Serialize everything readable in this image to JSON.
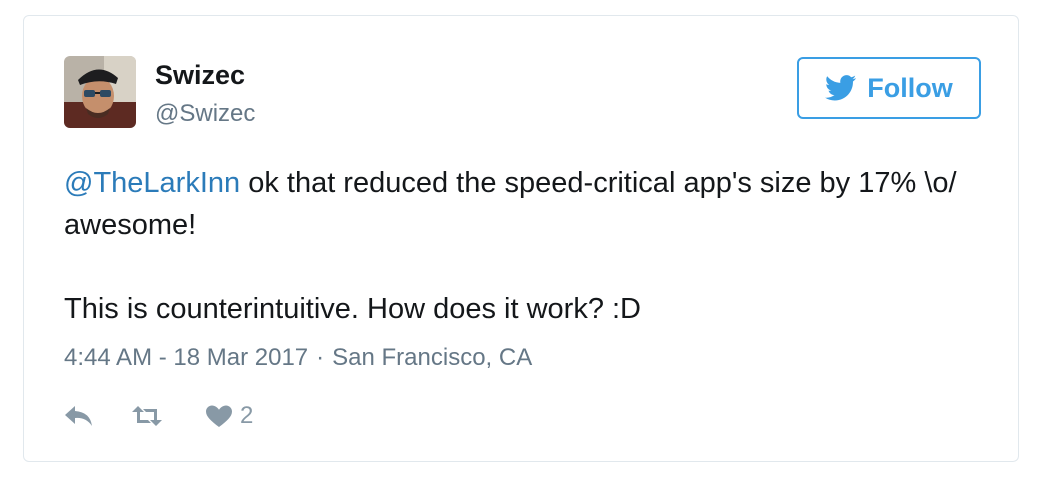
{
  "tweet": {
    "author_name": "Swizec",
    "author_handle": "@Swizec",
    "follow_label": "Follow",
    "mention": "@TheLarkInn",
    "text_line1": " ok that reduced the speed-critical app's size by 17% \\o/ awesome!",
    "text_line2": "This is counterintuitive. How does it work? :D",
    "time": "4:44 AM - 18 Mar 2017",
    "separator": "·",
    "location": "San Francisco, CA",
    "like_count": "2"
  },
  "icons": {
    "follow": "twitter-bird-icon",
    "reply": "reply-icon",
    "retweet": "retweet-icon",
    "like": "heart-icon"
  },
  "colors": {
    "accent": "#3a9ee4",
    "mention": "#2b7bb9",
    "muted": "#657786",
    "icon": "#8899a6",
    "text": "#14171a"
  }
}
